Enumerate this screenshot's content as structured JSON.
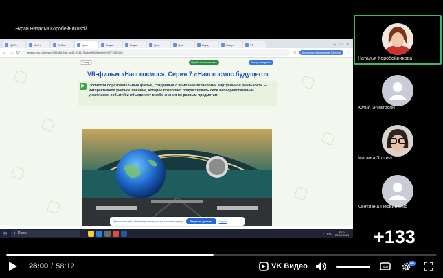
{
  "screen_label": "Экран Натальи Коробейниковой",
  "browser": {
    "tabs": [
      {
        "label": "ЦОС -"
      },
      {
        "label": "Мой с"
      },
      {
        "label": "Вебин"
      },
      {
        "label": "Урок"
      },
      {
        "label": "Задан"
      },
      {
        "label": "Задан"
      },
      {
        "label": "Урок"
      },
      {
        "label": "Урок"
      },
      {
        "label": "Ворд"
      },
      {
        "label": "Сферу"
      },
      {
        "label": "VR"
      }
    ],
    "url": "lesson.edu.ru/lesson/392686-5bb-4d42-9751-71ebb0ff35/task/id=%2F1552194",
    "update_label": "Доступно обновление Chrome"
  },
  "lesson": {
    "title": "VR-фильм «Наш космос». Серия 7 «Наш космос будущего»",
    "note_text": "Посмотри образовательный фильм, созданный с помощью технологии виртуальной реальности — интерактивное учебное пособие, которое позволяет почувствовать себя непосредственным участником событий и объединяет в себе знания по разным предметам.",
    "top_buttons": [
      "Назад",
      "Музей «Космонавтики»",
      "Смотреть задание"
    ]
  },
  "notification": {
    "text": "Приложению веб-сайта предоставлен доступ к вашему экрану.",
    "ok_label": "Закрыть доступ",
    "secondary_label": "Скрыть"
  },
  "taskbar": {
    "search_label": "Поиск",
    "lang": "РУС",
    "time": "15:27",
    "date": "23.04.2024"
  },
  "participants": [
    {
      "name": "Наталья Коробейникова",
      "active": true
    },
    {
      "name": "Юлия Эгнатосян",
      "active": false
    },
    {
      "name": "Марина Зотова",
      "active": false
    },
    {
      "name": "Светлана Первиненко",
      "active": false
    }
  ],
  "more_participants": "+133",
  "player": {
    "current_time": "28:00",
    "separator": "/",
    "duration": "58:12",
    "progress_fraction": 0.481,
    "brand": "VK Видео",
    "quality_badge": "HD",
    "accent_color": "#3db76a"
  }
}
